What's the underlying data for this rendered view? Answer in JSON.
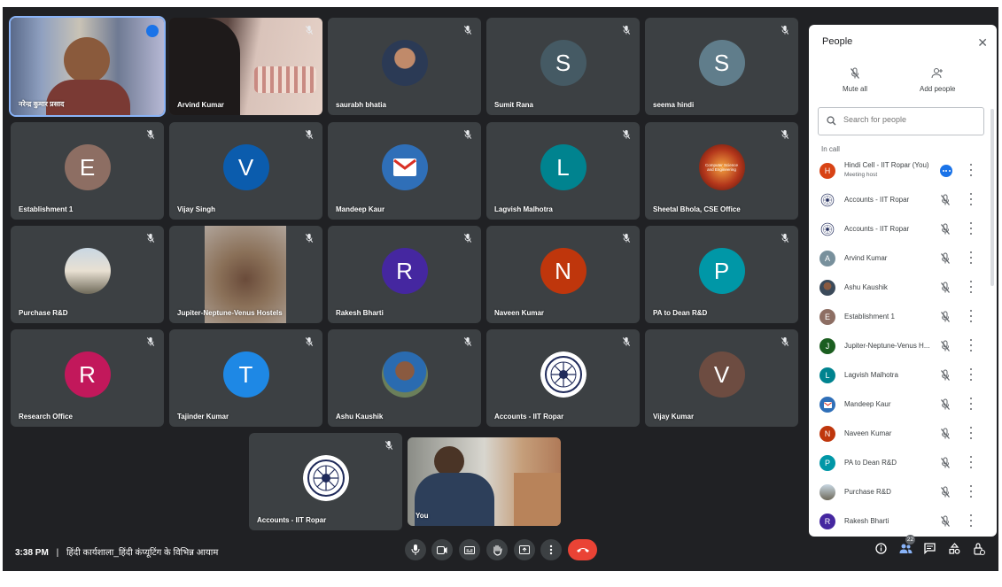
{
  "meeting": {
    "time": "3:38 PM",
    "separator": "|",
    "title": "हिंदी कार्यशाला_हिंदी कंप्यूटिंग के विभिन्न आयाम",
    "participant_count": "22"
  },
  "tiles": {
    "t1": "नरेन्द्र कुमार प्रसाद",
    "t2": "Arvind Kumar",
    "t3": "saurabh bhatia",
    "t4": "Sumit Rana",
    "t5": "seema hindi",
    "t6": "Establishment 1",
    "t7": "Vijay Singh",
    "t8": "Mandeep Kaur",
    "t9": "Lagvish Malhotra",
    "t10": "Sheetal Bhola, CSE Office",
    "t11": "Purchase R&D",
    "t12": "Jupiter-Neptune-Venus Hostels",
    "t13": "Rakesh Bharti",
    "t14": "Naveen Kumar",
    "t15": "PA to Dean R&D",
    "t16": "Research Office",
    "t17": "Tajinder Kumar",
    "t18": "Ashu Kaushik",
    "t19": "Accounts - IIT Ropar",
    "t20": "Vijay Kumar",
    "t21": "Accounts - IIT Ropar",
    "t22": "You"
  },
  "avatars": {
    "sumit": "S",
    "seema": "S",
    "establishment": "E",
    "vijay_singh": "V",
    "lagvish": "L",
    "rakesh": "R",
    "naveen": "N",
    "pa_dean": "P",
    "research": "R",
    "tajinder": "T",
    "vijay_kumar": "V"
  },
  "sheetal_avatar_text": "Computer Science and Engineering",
  "panel": {
    "title": "People",
    "mute_all": "Mute all",
    "add_people": "Add people",
    "search_placeholder": "Search for people",
    "section": "In call",
    "people": [
      {
        "name": "Hindi Cell - IIT Ropar (You)",
        "sub": "Meeting host",
        "initial": "H"
      },
      {
        "name": "Accounts - IIT Ropar"
      },
      {
        "name": "Accounts - IIT Ropar"
      },
      {
        "name": "Arvind Kumar",
        "initial": "A"
      },
      {
        "name": "Ashu Kaushik"
      },
      {
        "name": "Establishment 1",
        "initial": "E"
      },
      {
        "name": "Jupiter-Neptune-Venus H...",
        "initial": "J"
      },
      {
        "name": "Lagvish Malhotra",
        "initial": "L"
      },
      {
        "name": "Mandeep Kaur"
      },
      {
        "name": "Naveen Kumar",
        "initial": "N"
      },
      {
        "name": "PA to Dean R&D",
        "initial": "P"
      },
      {
        "name": "Purchase R&D"
      },
      {
        "name": "Rakesh Bharti",
        "initial": "R"
      }
    ]
  },
  "colors": {
    "background": "#202124",
    "tile": "#3c4043",
    "end_call": "#ea4335",
    "accent": "#1a73e8"
  },
  "icons": [
    "mic-off-icon",
    "mic-icon",
    "camera-icon",
    "captions-icon",
    "raise-hand-icon",
    "present-icon",
    "more-icon",
    "end-call-icon",
    "info-icon",
    "people-icon",
    "chat-icon",
    "activities-icon",
    "host-controls-icon",
    "search-icon",
    "close-icon"
  ]
}
